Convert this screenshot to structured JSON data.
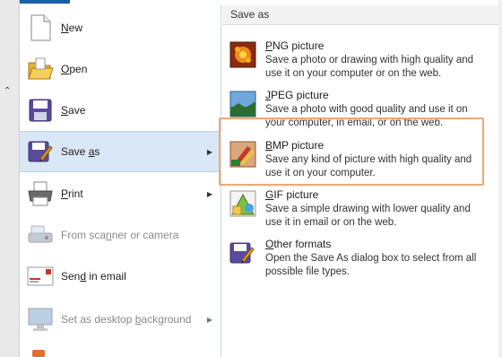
{
  "menu": {
    "items": [
      {
        "label_pre": "",
        "label_u": "N",
        "label_post": "ew",
        "icon": "new-document-icon",
        "disabled": false,
        "has_submenu": false
      },
      {
        "label_pre": "",
        "label_u": "O",
        "label_post": "pen",
        "icon": "open-folder-icon",
        "disabled": false,
        "has_submenu": false
      },
      {
        "label_pre": "",
        "label_u": "S",
        "label_post": "ave",
        "icon": "save-disk-icon",
        "disabled": false,
        "has_submenu": false
      },
      {
        "label_pre": "Save ",
        "label_u": "a",
        "label_post": "s",
        "icon": "save-as-icon",
        "disabled": false,
        "has_submenu": true,
        "active": true
      },
      {
        "label_pre": "",
        "label_u": "P",
        "label_post": "rint",
        "icon": "printer-icon",
        "disabled": false,
        "has_submenu": true
      },
      {
        "label_pre": "From sca",
        "label_u": "n",
        "label_post": "ner or camera",
        "icon": "scanner-icon",
        "disabled": true,
        "has_submenu": false
      },
      {
        "label_pre": "Sen",
        "label_u": "d",
        "label_post": " in email",
        "icon": "email-icon",
        "disabled": false,
        "has_submenu": false
      },
      {
        "label_pre": "Set as desktop ",
        "label_u": "b",
        "label_post": "ackground",
        "icon": "desktop-background-icon",
        "disabled": true,
        "has_submenu": true
      }
    ]
  },
  "panel": {
    "header": "Save as",
    "options": [
      {
        "title_u": "P",
        "title_rest": "NG picture",
        "desc": "Save a photo or drawing with high quality and use it on your computer or on the web.",
        "icon": "png-picture-icon"
      },
      {
        "title_u": "J",
        "title_rest": "PEG picture",
        "desc": "Save a photo with good quality and use it on your computer, in email, or on the web.",
        "icon": "jpeg-picture-icon"
      },
      {
        "title_u": "B",
        "title_rest": "MP picture",
        "desc": "Save any kind of picture with high quality and use it on your computer.",
        "icon": "bmp-picture-icon"
      },
      {
        "title_u": "G",
        "title_rest": "IF picture",
        "desc": "Save a simple drawing with lower quality and use it in email or on the web.",
        "icon": "gif-picture-icon"
      },
      {
        "title_u": "O",
        "title_rest": "ther formats",
        "desc": "Open the Save As dialog box to select from all possible file types.",
        "icon": "other-formats-icon"
      }
    ]
  },
  "colors": {
    "active_bg": "#d9e7f6",
    "highlight_border": "#f0a774",
    "disabled_text": "#8a8a8a"
  }
}
